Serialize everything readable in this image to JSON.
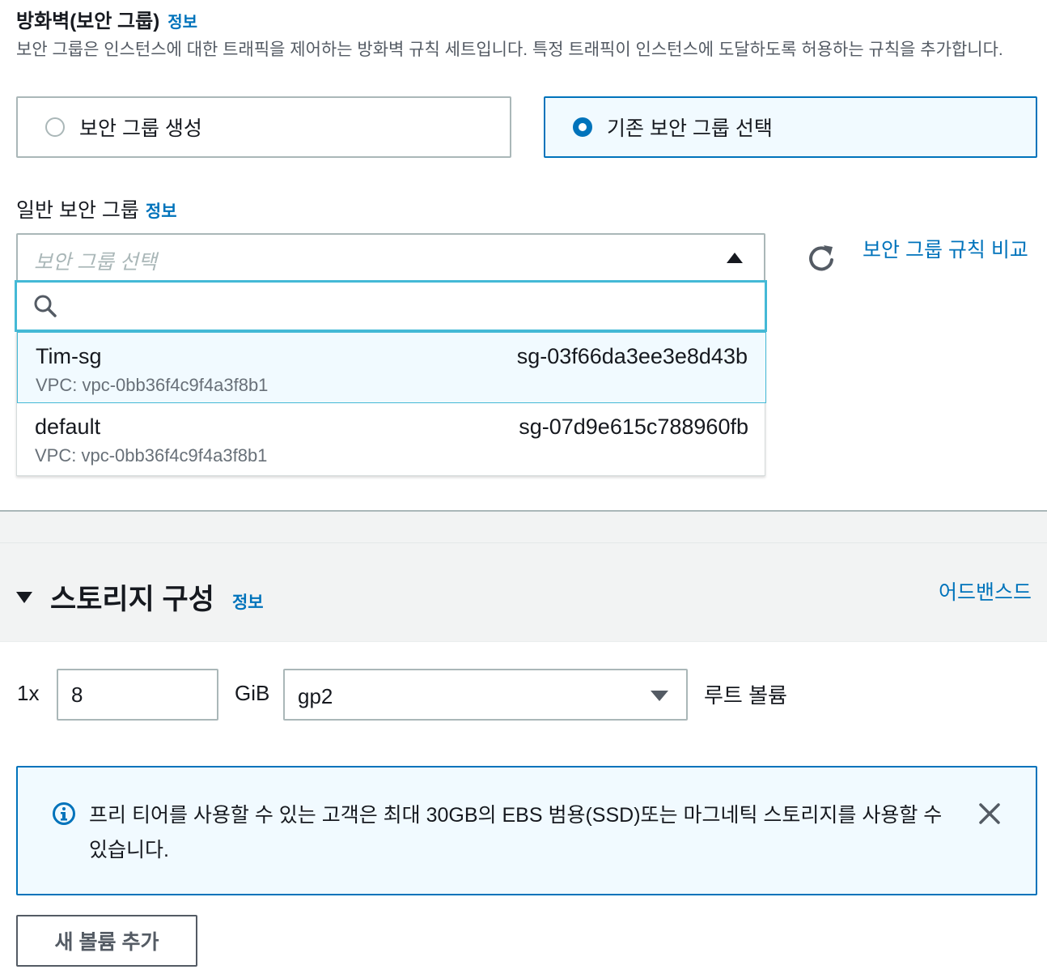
{
  "firewall": {
    "title": "방화벽(보안 그룹)",
    "info_link": "정보",
    "description": "보안 그룹은 인스턴스에 대한 트래픽을 제어하는 방화벽 규칙 세트입니다. 특정 트래픽이 인스턴스에 도달하도록 허용하는 규칙을 추가합니다.",
    "options": [
      {
        "label": "보안 그룹 생성",
        "selected": false
      },
      {
        "label": "기존 보안 그룹 선택",
        "selected": true
      }
    ]
  },
  "security_group_select": {
    "label": "일반 보안 그룹",
    "info_link": "정보",
    "placeholder": "보안 그룹 선택",
    "search_value": "",
    "items": [
      {
        "name": "Tim-sg",
        "vpc": "VPC: vpc-0bb36f4c9f4a3f8b1",
        "id": "sg-03f66da3ee3e8d43b",
        "highlighted": true
      },
      {
        "name": "default",
        "vpc": "VPC: vpc-0bb36f4c9f4a3f8b1",
        "id": "sg-07d9e615c788960fb",
        "highlighted": false
      }
    ],
    "compare_link": "보안 그룹 규칙 비교",
    "refresh_icon": "refresh-icon"
  },
  "storage": {
    "title": "스토리지 구성",
    "info_link": "정보",
    "advanced_link": "어드밴스드",
    "quantity": "1x",
    "size_value": "8",
    "unit": "GiB",
    "volume_type": "gp2",
    "volume_label": "루트 볼륨",
    "alert": {
      "text": "프리 티어를 사용할 수 있는 고객은 최대 30GB의 EBS 범용(SSD)또는 마그네틱 스토리지를 사용할 수 있습니다.",
      "icon": "info-icon",
      "close_icon": "close-icon"
    },
    "add_volume_button": "새 볼륨 추가"
  },
  "colors": {
    "link": "#0073bb",
    "focus": "#44b9d6",
    "selected_bg": "#f1faff",
    "border": "#aab7b8"
  }
}
